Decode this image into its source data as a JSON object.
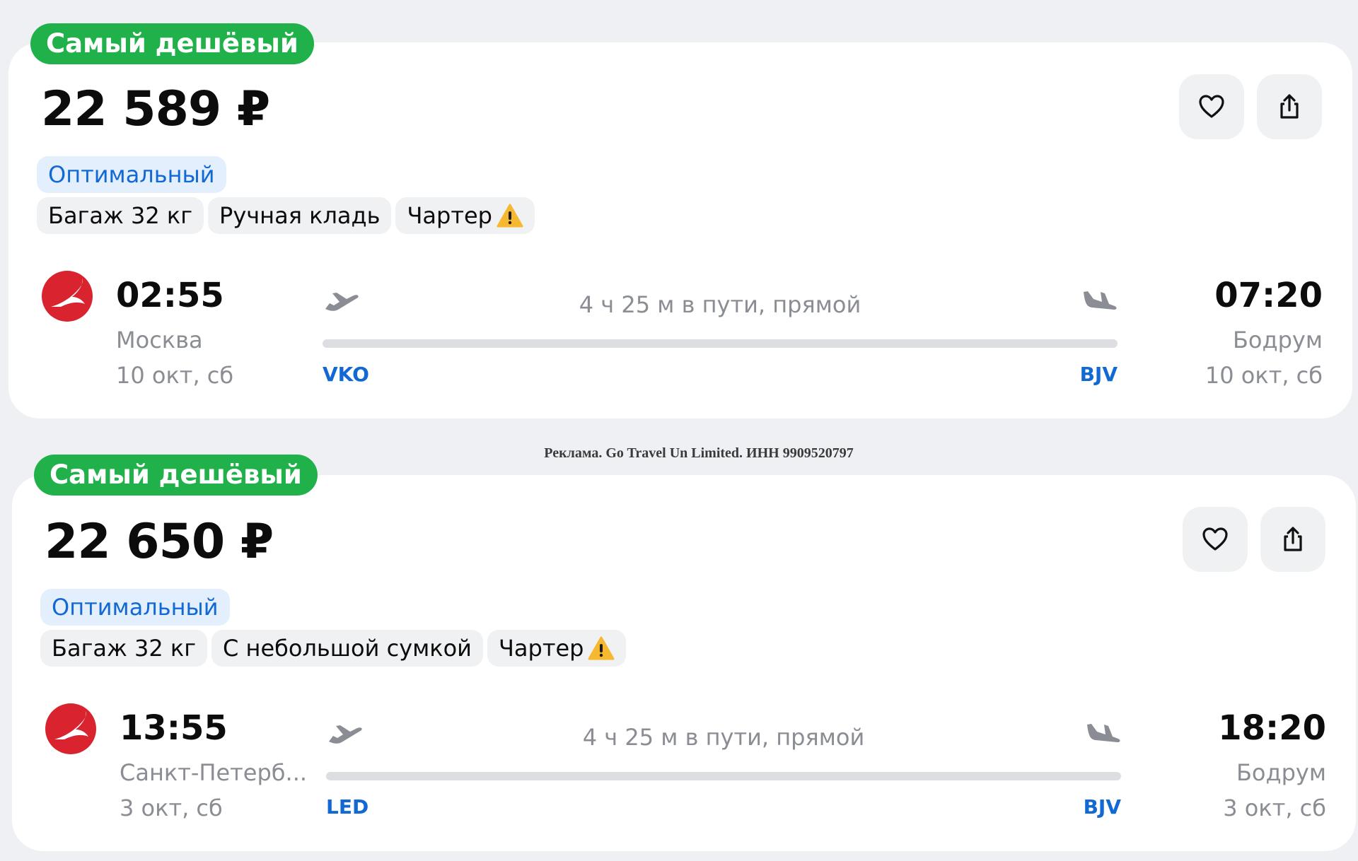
{
  "colors": {
    "badge_green": "#20b14a",
    "fare_blue": "#1369d4",
    "fare_bg": "#e3effc",
    "tag_bg": "#f0f1f3",
    "warning": "#f5b82e",
    "airline_red": "#d9232e"
  },
  "icons": {
    "favorite": "heart-icon",
    "share": "share-icon",
    "warning": "warning-triangle-icon",
    "takeoff": "plane-takeoff-icon",
    "landing": "plane-landing-icon",
    "airline": "turkish-airlines-logo"
  },
  "ad_text": "Реклама. Go Travel Un Limited. ИНН 9909520797",
  "offers": [
    {
      "badge": "Самый дешёвый",
      "price": "22 589 ₽",
      "fare": "Оптимальный",
      "tags": [
        "Багаж 32 кг",
        "Ручная кладь",
        "Чартер"
      ],
      "departure": {
        "time": "02:55",
        "city": "Москва",
        "date": "10 окт, сб",
        "iata": "VKO"
      },
      "arrival": {
        "time": "07:20",
        "city": "Бодрум",
        "date": "10 окт, сб",
        "iata": "BJV"
      },
      "duration": "4 ч 25 м в пути, прямой"
    },
    {
      "badge": "Самый дешёвый",
      "price": "22 650 ₽",
      "fare": "Оптимальный",
      "tags": [
        "Багаж 32 кг",
        "С небольшой сумкой",
        "Чартер"
      ],
      "departure": {
        "time": "13:55",
        "city": "Санкт-Петерб...",
        "date": "3 окт, сб",
        "iata": "LED"
      },
      "arrival": {
        "time": "18:20",
        "city": "Бодрум",
        "date": "3 окт, сб",
        "iata": "BJV"
      },
      "duration": "4 ч 25 м в пути, прямой"
    }
  ]
}
